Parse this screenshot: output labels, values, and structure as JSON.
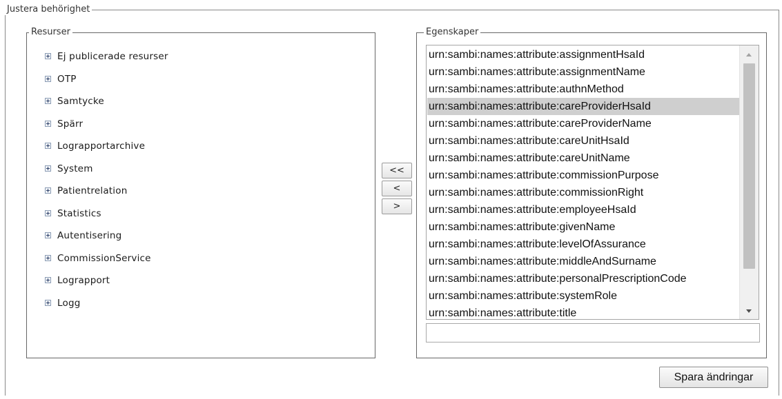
{
  "panel": {
    "title": "Justera behörighet"
  },
  "resources": {
    "title": "Resurser",
    "items": [
      {
        "label": "Ej publicerade resurser"
      },
      {
        "label": "OTP"
      },
      {
        "label": "Samtycke"
      },
      {
        "label": "Spärr"
      },
      {
        "label": "Lograpportarchive"
      },
      {
        "label": "System"
      },
      {
        "label": "Patientrelation"
      },
      {
        "label": "Statistics"
      },
      {
        "label": "Autentisering"
      },
      {
        "label": "CommissionService"
      },
      {
        "label": "Lograpport"
      },
      {
        "label": "Logg"
      }
    ],
    "expander_icon": "expand-plus-icon"
  },
  "move_buttons": {
    "move_all_left": "<<",
    "move_left": "<",
    "move_right": ">"
  },
  "properties": {
    "title": "Egenskaper",
    "selected": "urn:sambi:names:attribute:careProviderHsaId",
    "options": [
      "urn:sambi:names:attribute:assignmentHsaId",
      "urn:sambi:names:attribute:assignmentName",
      "urn:sambi:names:attribute:authnMethod",
      "urn:sambi:names:attribute:careProviderHsaId",
      "urn:sambi:names:attribute:careProviderName",
      "urn:sambi:names:attribute:careUnitHsaId",
      "urn:sambi:names:attribute:careUnitName",
      "urn:sambi:names:attribute:commissionPurpose",
      "urn:sambi:names:attribute:commissionRight",
      "urn:sambi:names:attribute:employeeHsaId",
      "urn:sambi:names:attribute:givenName",
      "urn:sambi:names:attribute:levelOfAssurance",
      "urn:sambi:names:attribute:middleAndSurname",
      "urn:sambi:names:attribute:personalPrescriptionCode",
      "urn:sambi:names:attribute:systemRole",
      "urn:sambi:names:attribute:title"
    ],
    "input_value": ""
  },
  "actions": {
    "save_label": "Spara ändringar"
  },
  "colors": {
    "selection_background": "#cfcfcf",
    "scrollbar_thumb": "#c1c1c1",
    "border": "#888888"
  }
}
